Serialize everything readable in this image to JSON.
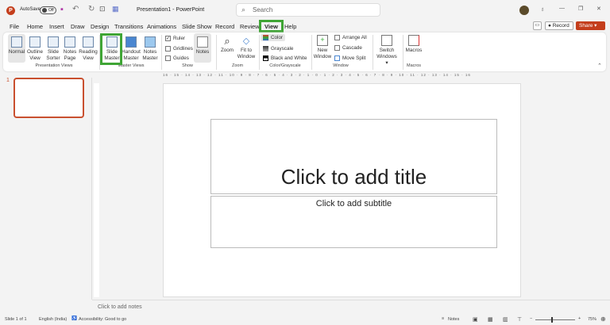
{
  "titlebar": {
    "app_letter": "P",
    "autosave_label": "AutoSave",
    "autosave_state": "Off",
    "title": "Presentation1  -  PowerPoint",
    "search_placeholder": "Search",
    "minimize": "—",
    "restore": "❐",
    "close": "✕"
  },
  "tabs": [
    "File",
    "Home",
    "Insert",
    "Draw",
    "Design",
    "Transitions",
    "Animations",
    "Slide Show",
    "Record",
    "Review",
    "View",
    "Help"
  ],
  "active_tab": "View",
  "record_button": "Record",
  "share_button": "Share",
  "ribbon": {
    "presentation_views": {
      "label": "Presentation Views",
      "items": [
        "Normal",
        "Outline View",
        "Slide Sorter",
        "Notes Page",
        "Reading View"
      ]
    },
    "master_views": {
      "label": "Master Views",
      "items": [
        "Slide Master",
        "Handout Master",
        "Notes Master"
      ]
    },
    "show": {
      "label": "Show",
      "checks": [
        {
          "label": "Ruler",
          "checked": true
        },
        {
          "label": "Gridlines",
          "checked": false
        },
        {
          "label": "Guides",
          "checked": false
        }
      ],
      "notes": "Notes"
    },
    "zoom": {
      "label": "Zoom",
      "items": [
        "Zoom",
        "Fit to Window"
      ]
    },
    "color": {
      "label": "Color/Grayscale",
      "items": [
        "Color",
        "Grayscale",
        "Black and White"
      ]
    },
    "window": {
      "label": "Window",
      "new_window": "New Window",
      "items": [
        "Arrange All",
        "Cascade",
        "Move Split"
      ],
      "switch": "Switch Windows"
    },
    "macros": {
      "label": "Macros",
      "item": "Macros"
    }
  },
  "ruler_text": "16 · 15 · 14 · 13 · 12 · 11 · 10 · 9 · 8 · 7 · 6 · 5 · 4 · 3 · 2 · 1 · 0 · 1 · 2 · 3 · 4 · 5 · 6 · 7 · 8 · 9 · 10 · 11 · 12 · 13 · 14 · 15 · 16",
  "thumbnail_number": "1",
  "slide": {
    "title_placeholder": "Click to add title",
    "subtitle_placeholder": "Click to add subtitle"
  },
  "notes_placeholder": "Click to add notes",
  "status": {
    "slide": "Slide 1 of 1",
    "language": "English (India)",
    "accessibility": "Accessibility: Good to go",
    "notes": "Notes",
    "zoom": "75%",
    "zoom_level": 0.75
  },
  "colors": {
    "accent": "#c43e1c",
    "highlight": "#3fa535"
  }
}
